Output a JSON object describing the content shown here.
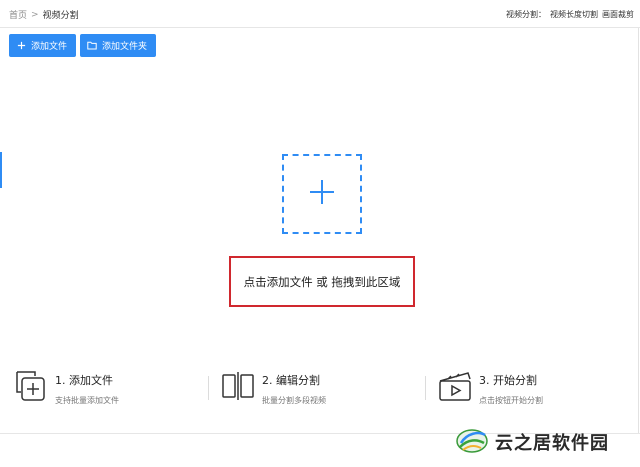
{
  "breadcrumb": {
    "home": "首页",
    "separator": ">",
    "current": "视频分割"
  },
  "top_right": {
    "prefix": "视频分割：",
    "mode1": "视频长度切割",
    "mode2": "画面裁剪"
  },
  "toolbar": {
    "add_file_label": "添加文件",
    "add_folder_label": "添加文件夹",
    "add_file_icon": "plus-icon",
    "add_folder_icon": "folder-icon"
  },
  "dropzone": {
    "icon": "plus-icon",
    "hint": "点击添加文件 或 拖拽到此区域"
  },
  "steps": [
    {
      "title": "1. 添加文件",
      "desc": "支持批量添加文件",
      "icon": "add-files-icon"
    },
    {
      "title": "2. 编辑分割",
      "desc": "批量分割多段视频",
      "icon": "split-icon"
    },
    {
      "title": "3. 开始分割",
      "desc": "点击按钮开始分割",
      "icon": "clapper-play-icon"
    }
  ],
  "watermark": {
    "text": "云之居软件园"
  },
  "colors": {
    "accent": "#2f8cf4",
    "highlight": "#d0282e"
  }
}
